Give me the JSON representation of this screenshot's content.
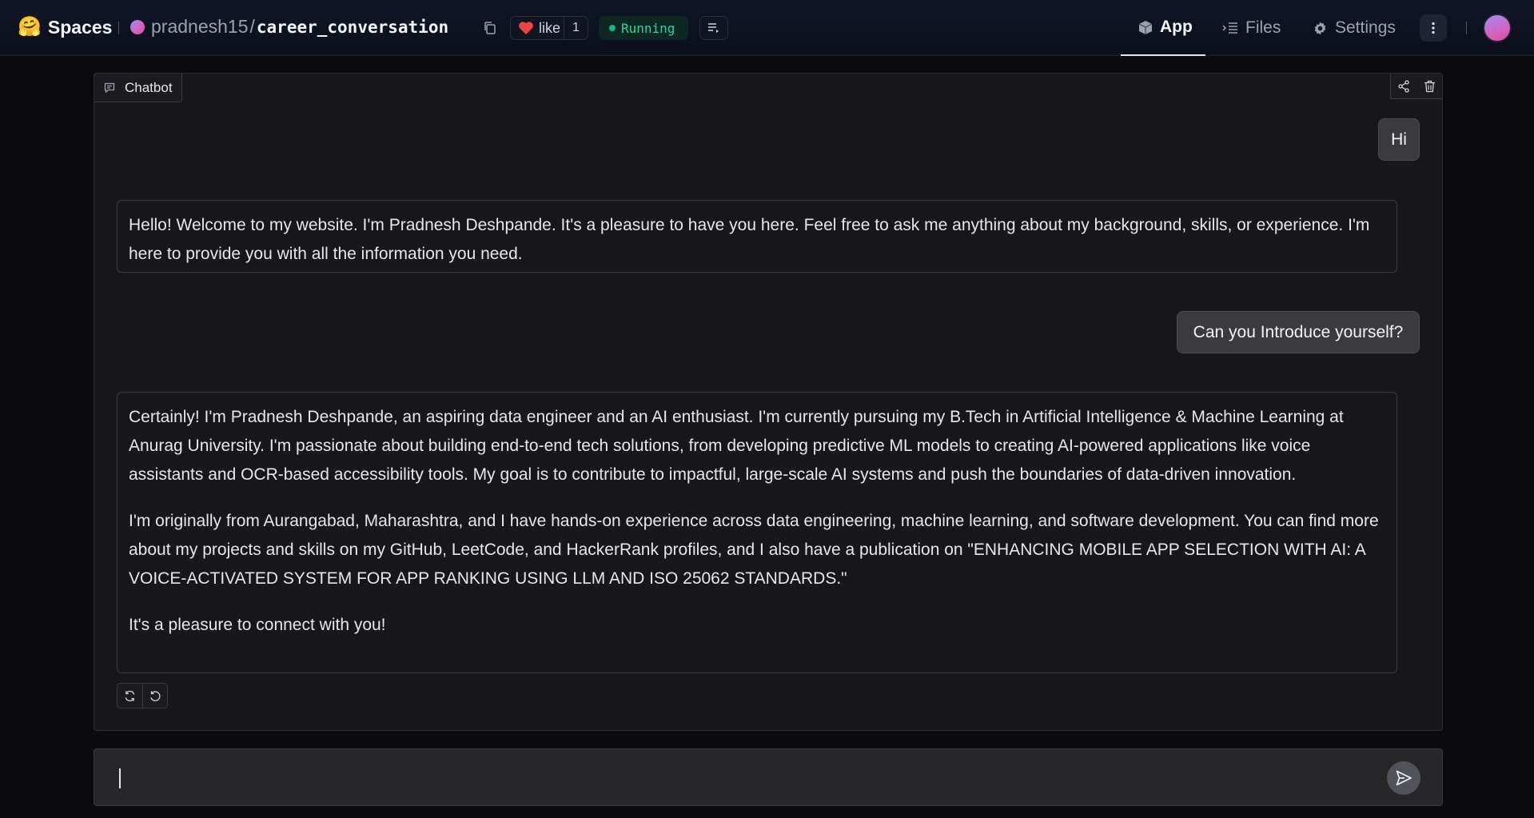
{
  "header": {
    "brand_icon": "🤗",
    "brand": "Spaces",
    "repo_owner": "pradnesh15",
    "repo_separator": "/",
    "repo_name": "career_conversation",
    "like_label": "like",
    "like_count": "1",
    "status": "Running",
    "status_color": "#10b981",
    "tabs": [
      {
        "label": "App",
        "icon": "cube-icon",
        "active": true
      },
      {
        "label": "Files",
        "icon": "files-icon",
        "active": false
      },
      {
        "label": "Settings",
        "icon": "gear-icon",
        "active": false
      }
    ]
  },
  "chatbot": {
    "label": "Chatbot",
    "messages": [
      {
        "role": "user",
        "text": "Hi"
      },
      {
        "role": "assistant",
        "paragraphs": [
          "Hello! Welcome to my website. I'm Pradnesh Deshpande. It's a pleasure to have you here. Feel free to ask me anything about my background, skills, or experience. I'm here to provide you with all the information you need."
        ]
      },
      {
        "role": "user",
        "text": "Can you Introduce yourself?"
      },
      {
        "role": "assistant",
        "paragraphs": [
          "Certainly! I'm Pradnesh Deshpande, an aspiring data engineer and an AI enthusiast. I'm currently pursuing my B.Tech in Artificial Intelligence & Machine Learning at Anurag University. I'm passionate about building end-to-end tech solutions, from developing predictive ML models to creating AI-powered applications like voice assistants and OCR-based accessibility tools. My goal is to contribute to impactful, large-scale AI systems and push the boundaries of data-driven innovation.",
          "I'm originally from Aurangabad, Maharashtra, and I have hands-on experience across data engineering, machine learning, and software development. You can find more about my projects and skills on my GitHub, LeetCode, and HackerRank profiles, and I also have a publication on \"ENHANCING MOBILE APP SELECTION WITH AI: A VOICE-ACTIVATED SYSTEM FOR APP RANKING USING LLM AND ISO 25062 STANDARDS.\"",
          "It's a pleasure to connect with you!"
        ]
      }
    ]
  },
  "input": {
    "value": "",
    "placeholder": ""
  },
  "colors": {
    "accent_like": "#ef4444",
    "background": "#0b0b0f",
    "panel": "#18181b"
  }
}
